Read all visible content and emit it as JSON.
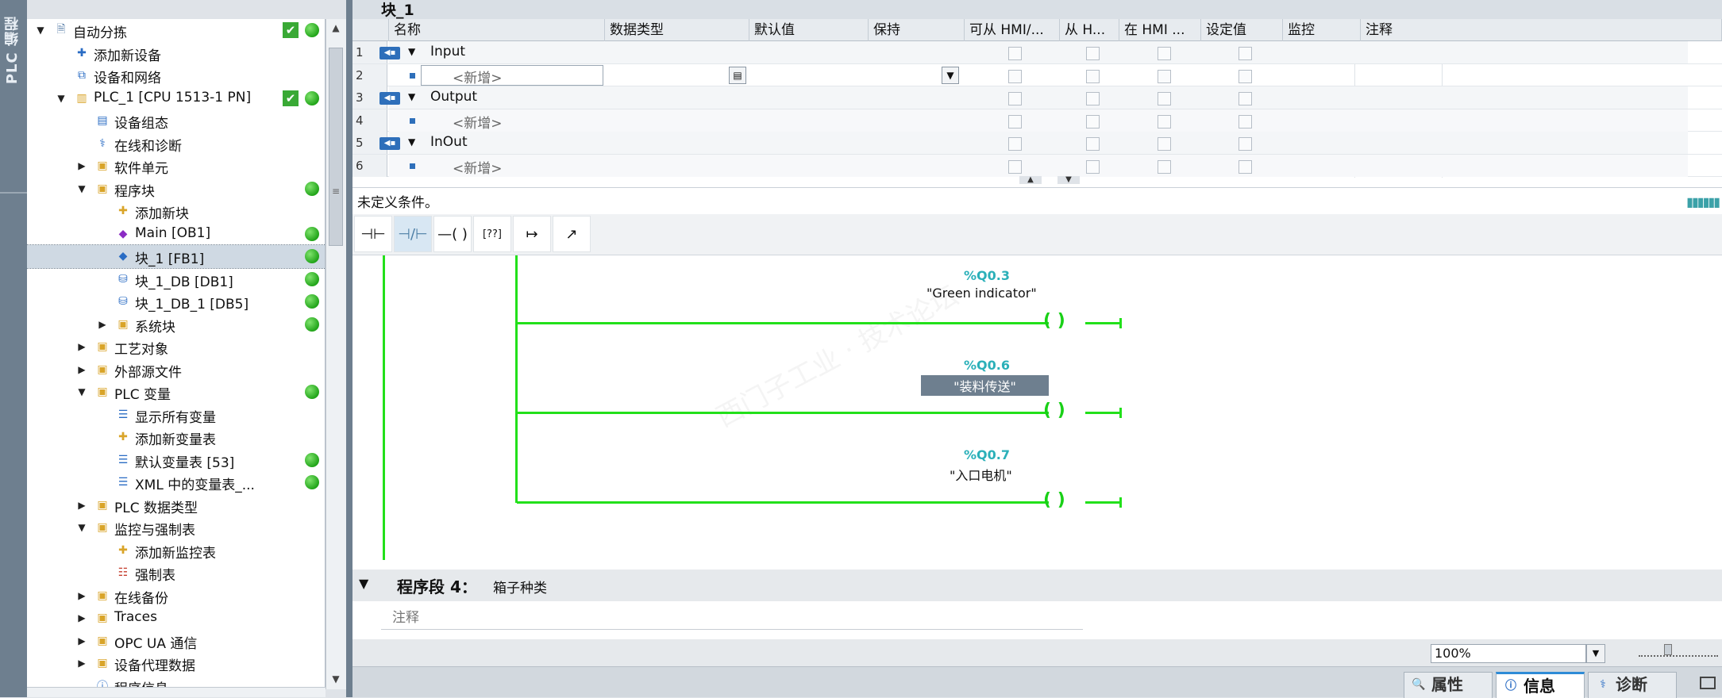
{
  "side_tab": {
    "label": "PLC 编程"
  },
  "tree": {
    "rows": [
      {
        "label": "自动分拣",
        "icon": "project-icon",
        "level": 0,
        "expand": "open",
        "check": true,
        "dot": true
      },
      {
        "label": "添加新设备",
        "icon": "add-device-icon",
        "level": 1,
        "expand": "",
        "check": false,
        "dot": false
      },
      {
        "label": "设备和网络",
        "icon": "network-icon",
        "level": 1,
        "expand": "",
        "check": false,
        "dot": false
      },
      {
        "label": "PLC_1 [CPU 1513-1 PN]",
        "icon": "plc-icon",
        "level": 1,
        "expand": "open",
        "check": true,
        "dot": true
      },
      {
        "label": "设备组态",
        "icon": "device-config-icon",
        "level": 2,
        "expand": "",
        "check": false,
        "dot": false
      },
      {
        "label": "在线和诊断",
        "icon": "diagnostics-icon",
        "level": 2,
        "expand": "",
        "check": false,
        "dot": false
      },
      {
        "label": "软件单元",
        "icon": "folder-icon",
        "level": 2,
        "expand": "closed",
        "check": false,
        "dot": false
      },
      {
        "label": "程序块",
        "icon": "folder-icon",
        "level": 2,
        "expand": "open",
        "check": false,
        "dot": true
      },
      {
        "label": "添加新块",
        "icon": "add-block-icon",
        "level": 3,
        "expand": "",
        "check": false,
        "dot": false
      },
      {
        "label": "Main [OB1]",
        "icon": "ob-icon",
        "level": 3,
        "expand": "",
        "check": false,
        "dot": true
      },
      {
        "label": "块_1 [FB1]",
        "icon": "fb-icon",
        "level": 3,
        "expand": "",
        "check": false,
        "dot": true,
        "selected": true
      },
      {
        "label": "块_1_DB [DB1]",
        "icon": "db-icon",
        "level": 3,
        "expand": "",
        "check": false,
        "dot": true
      },
      {
        "label": "块_1_DB_1 [DB5]",
        "icon": "db-icon",
        "level": 3,
        "expand": "",
        "check": false,
        "dot": true
      },
      {
        "label": "系统块",
        "icon": "folder-icon",
        "level": 3,
        "expand": "closed",
        "check": false,
        "dot": true
      },
      {
        "label": "工艺对象",
        "icon": "folder-icon",
        "level": 2,
        "expand": "closed",
        "check": false,
        "dot": false
      },
      {
        "label": "外部源文件",
        "icon": "folder-icon",
        "level": 2,
        "expand": "closed",
        "check": false,
        "dot": false
      },
      {
        "label": "PLC 变量",
        "icon": "folder-icon",
        "level": 2,
        "expand": "open",
        "check": false,
        "dot": true
      },
      {
        "label": "显示所有变量",
        "icon": "tag-table-icon",
        "level": 3,
        "expand": "",
        "check": false,
        "dot": false
      },
      {
        "label": "添加新变量表",
        "icon": "add-table-icon",
        "level": 3,
        "expand": "",
        "check": false,
        "dot": false
      },
      {
        "label": "默认变量表 [53]",
        "icon": "tag-table-icon",
        "level": 3,
        "expand": "",
        "check": false,
        "dot": true
      },
      {
        "label": "XML 中的变量表_...",
        "icon": "tag-table-icon",
        "level": 3,
        "expand": "",
        "check": false,
        "dot": true
      },
      {
        "label": "PLC 数据类型",
        "icon": "folder-icon",
        "level": 2,
        "expand": "closed",
        "check": false,
        "dot": false
      },
      {
        "label": "监控与强制表",
        "icon": "folder-icon",
        "level": 2,
        "expand": "open",
        "check": false,
        "dot": false
      },
      {
        "label": "添加新监控表",
        "icon": "add-table-icon",
        "level": 3,
        "expand": "",
        "check": false,
        "dot": false
      },
      {
        "label": "强制表",
        "icon": "force-table-icon",
        "level": 3,
        "expand": "",
        "check": false,
        "dot": false
      },
      {
        "label": "在线备份",
        "icon": "folder-icon",
        "level": 2,
        "expand": "closed",
        "check": false,
        "dot": false
      },
      {
        "label": "Traces",
        "icon": "folder-icon",
        "level": 2,
        "expand": "closed",
        "check": false,
        "dot": false
      },
      {
        "label": "OPC UA 通信",
        "icon": "folder-icon",
        "level": 2,
        "expand": "closed",
        "check": false,
        "dot": false
      },
      {
        "label": "设备代理数据",
        "icon": "folder-icon",
        "level": 2,
        "expand": "closed",
        "check": false,
        "dot": false
      },
      {
        "label": "程序信息",
        "icon": "program-info-icon",
        "level": 2,
        "expand": "",
        "check": false,
        "dot": false
      }
    ]
  },
  "editor": {
    "block_title": "块_1",
    "interface": {
      "columns": [
        "名称",
        "数据类型",
        "默认值",
        "保持",
        "可从 HMI/...",
        "从 H...",
        "在 HMI ...",
        "设定值",
        "监控",
        "注释"
      ],
      "rows": [
        {
          "num": "1",
          "name": "Input",
          "kind": "section"
        },
        {
          "num": "2",
          "name": "<新增>",
          "kind": "new",
          "editing": true
        },
        {
          "num": "3",
          "name": "Output",
          "kind": "section"
        },
        {
          "num": "4",
          "name": "<新增>",
          "kind": "new"
        },
        {
          "num": "5",
          "name": "InOut",
          "kind": "section"
        },
        {
          "num": "6",
          "name": "<新增>",
          "kind": "new"
        }
      ]
    },
    "condition_text": "未定义条件。",
    "toolbar": [
      "normally-open-contact-icon",
      "normally-closed-contact-icon",
      "coil-icon",
      "empty-box-icon",
      "open-branch-icon",
      "close-branch-icon"
    ],
    "coils": [
      {
        "address": "%Q0.3",
        "name": "\"Green indicator\"",
        "highlight": false
      },
      {
        "address": "%Q0.6",
        "name": "\"装料传送\"",
        "highlight": true
      },
      {
        "address": "%Q0.7",
        "name": "\"入口电机\"",
        "highlight": false
      }
    ],
    "segment": {
      "title": "程序段 4：",
      "description": "箱子种类",
      "comment_placeholder": "注释"
    },
    "zoom": "100%",
    "bottom_tabs": [
      {
        "label": "属性",
        "icon": "properties-icon",
        "active": false
      },
      {
        "label": "信息",
        "icon": "info-icon",
        "active": true
      },
      {
        "label": "诊断",
        "icon": "diagnostics-icon",
        "active": false
      }
    ],
    "colors": {
      "rung": "#22e01a",
      "address": "#2bb0b9",
      "highlight": "#6e7f8f",
      "active_tab": "#2e8bd6"
    }
  }
}
